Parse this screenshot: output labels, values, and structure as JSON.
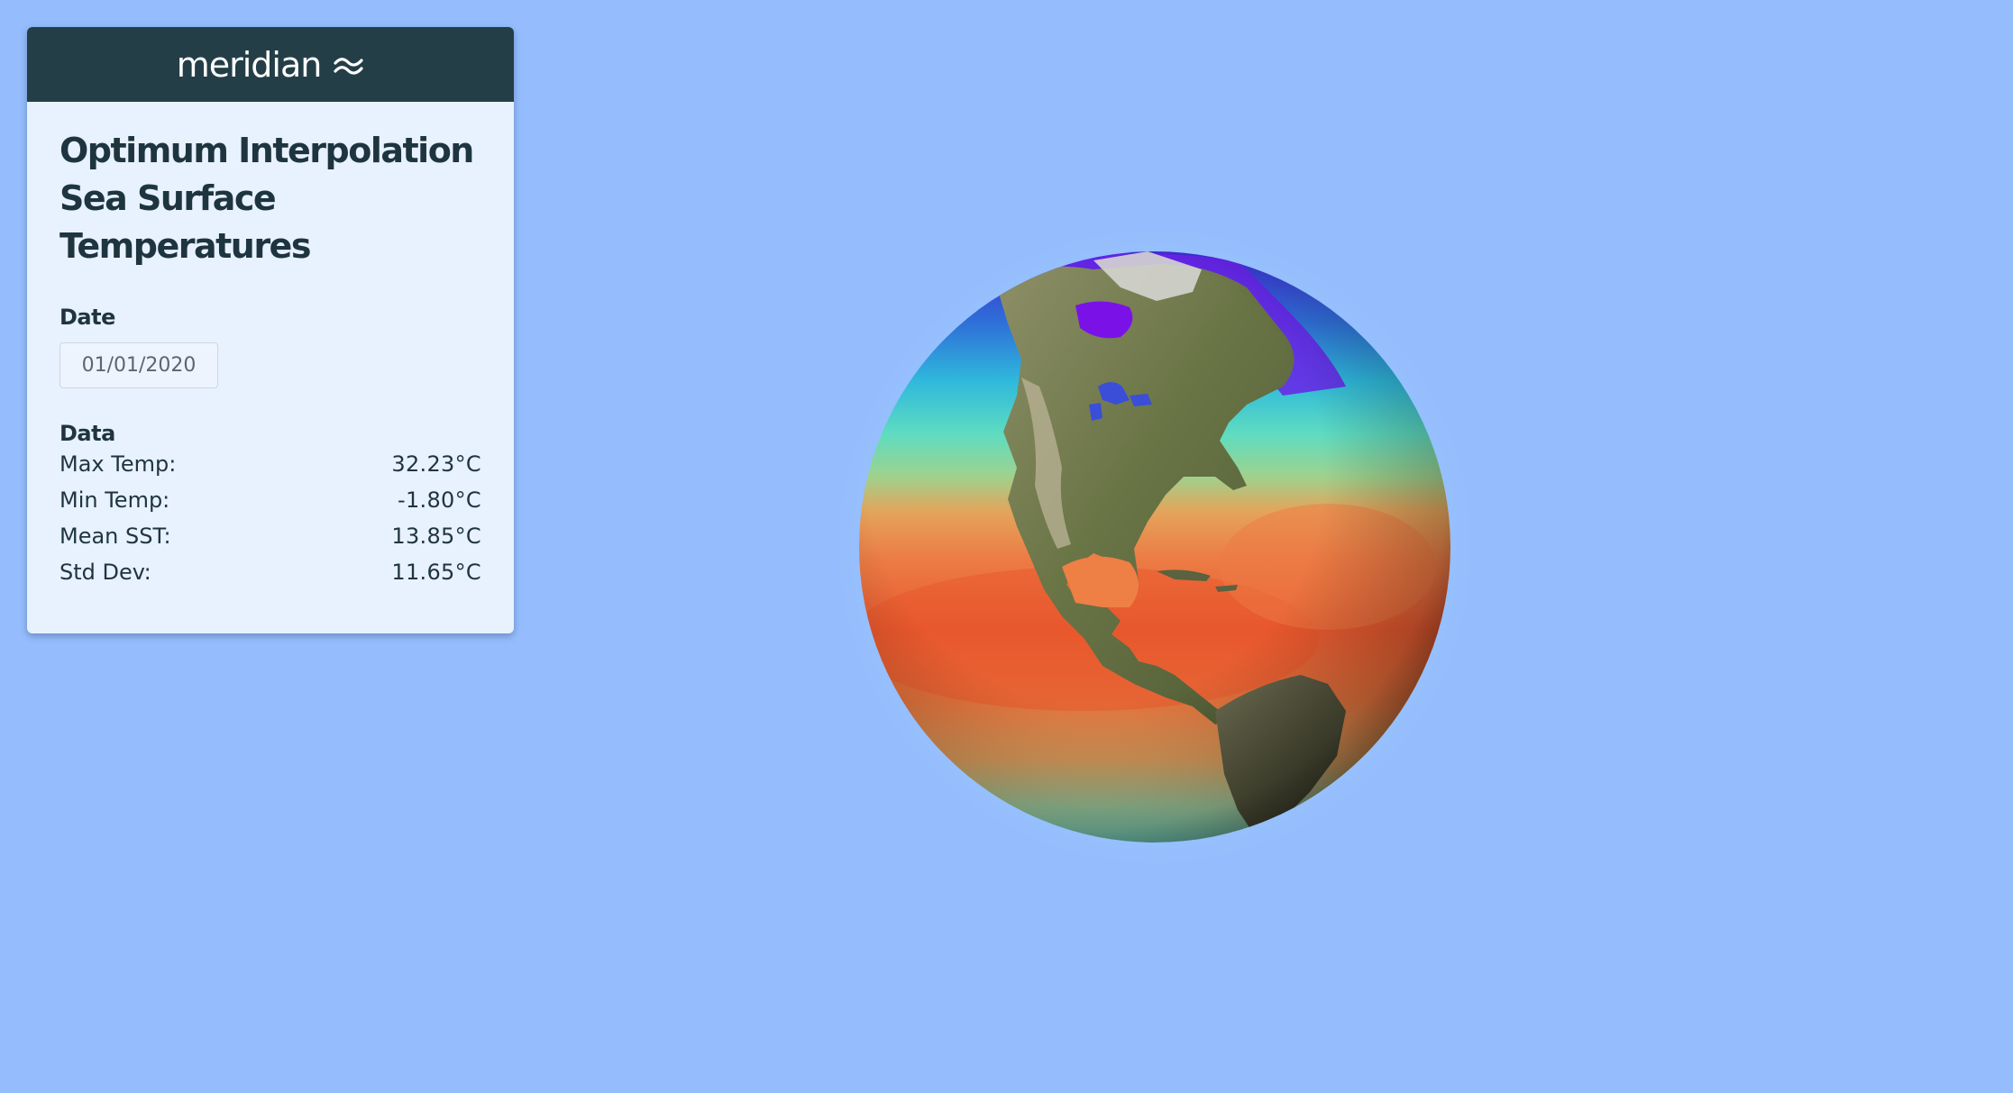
{
  "brand": {
    "name": "meridian",
    "logo_icon": "waves-icon"
  },
  "panel": {
    "title": "Optimum Interpolation Sea Surface Temperatures",
    "date_label": "Date",
    "date_value": "01/01/2020",
    "data_label": "Data",
    "stats": [
      {
        "label": "Max Temp:",
        "value": "32.23°C"
      },
      {
        "label": "Min Temp:",
        "value": "-1.80°C"
      },
      {
        "label": "Mean SST:",
        "value": "13.85°C"
      },
      {
        "label": "Std Dev:",
        "value": "11.65°C"
      }
    ]
  },
  "colors": {
    "background": "#95bdfd",
    "panel_header": "#243e48",
    "panel_body": "#e8f1fe",
    "text_dark": "#1e3540"
  }
}
